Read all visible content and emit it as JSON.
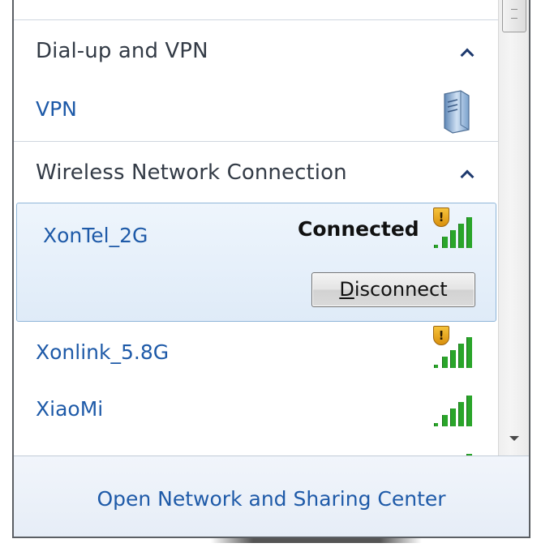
{
  "sections": [
    {
      "title": "Dial-up and VPN",
      "collapse_icon": "chevron-up-icon"
    },
    {
      "title": "Wireless Network Connection",
      "collapse_icon": "chevron-up-icon"
    }
  ],
  "vpn": {
    "name": "VPN",
    "icon": "vpn-server-icon"
  },
  "selected_network": {
    "name": "XonTel_2G",
    "status": "Connected",
    "signal_level": 1.0,
    "secured_warning": true,
    "button_mnemonic": "D",
    "button_rest": "isconnect"
  },
  "networks": [
    {
      "name": "Xonlink_5.8G",
      "signal_level": 1.0,
      "secured_warning": true
    },
    {
      "name": "XiaoMi",
      "signal_level": 1.0,
      "secured_warning": false
    }
  ],
  "footer": {
    "link": "Open Network and Sharing Center"
  },
  "colors": {
    "link": "#1e5aa8",
    "signal": "#2aa52a",
    "selection_bg": "#e3eef9"
  }
}
